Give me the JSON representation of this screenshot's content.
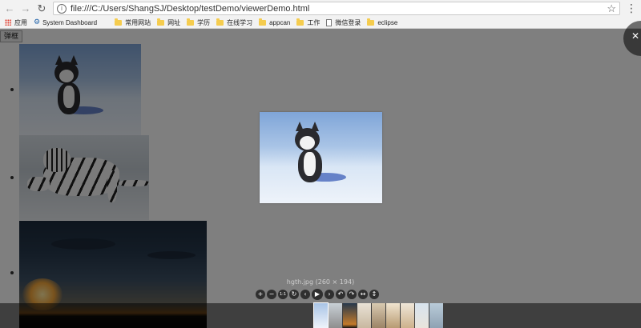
{
  "browser": {
    "url": "file:///C:/Users/ShangSJ/Desktop/testDemo/viewerDemo.html",
    "back_icon": "arrow-left-icon",
    "forward_icon": "arrow-right-icon",
    "reload_icon": "reload-icon",
    "info_icon": "info-icon",
    "star_icon": "star-icon",
    "menu_icon": "more-vertical-icon"
  },
  "bookmarks": [
    {
      "label": "应用",
      "icon": "apps-grid-icon"
    },
    {
      "label": "System Dashboard",
      "icon": "gear-icon"
    },
    {
      "label": "常用网站",
      "icon": "folder-icon"
    },
    {
      "label": "网址",
      "icon": "folder-icon"
    },
    {
      "label": "学历",
      "icon": "folder-icon"
    },
    {
      "label": "在线学习",
      "icon": "folder-icon"
    },
    {
      "label": "appcan",
      "icon": "folder-icon"
    },
    {
      "label": "工作",
      "icon": "folder-icon"
    },
    {
      "label": "微信登录",
      "icon": "document-icon"
    },
    {
      "label": "eclipse",
      "icon": "folder-icon"
    }
  ],
  "page": {
    "popup_button_label": "弹框",
    "images": [
      "husky",
      "tiger",
      "sunset"
    ]
  },
  "viewer": {
    "title": "hgth.jpg (260 × 194)",
    "close_icon": "close-icon",
    "toolbar": [
      {
        "name": "zoom-in",
        "glyph": "+"
      },
      {
        "name": "zoom-out",
        "glyph": "−"
      },
      {
        "name": "one-to-one",
        "glyph": "1:1"
      },
      {
        "name": "reset",
        "glyph": "↻"
      },
      {
        "name": "prev",
        "glyph": "‹"
      },
      {
        "name": "play",
        "glyph": "▶"
      },
      {
        "name": "next",
        "glyph": "›"
      },
      {
        "name": "rotate-left",
        "glyph": "↶"
      },
      {
        "name": "rotate-right",
        "glyph": "↷"
      },
      {
        "name": "flip-horizontal",
        "glyph": "↔"
      },
      {
        "name": "flip-vertical",
        "glyph": "↕"
      }
    ],
    "navbar_thumbnails": 9,
    "active_thumbnail": 1
  }
}
